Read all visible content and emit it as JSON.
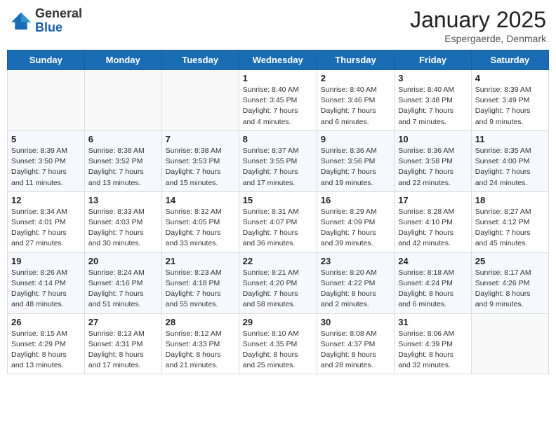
{
  "logo": {
    "general": "General",
    "blue": "Blue"
  },
  "header": {
    "month": "January 2025",
    "location": "Espergaerde, Denmark"
  },
  "weekdays": [
    "Sunday",
    "Monday",
    "Tuesday",
    "Wednesday",
    "Thursday",
    "Friday",
    "Saturday"
  ],
  "weeks": [
    [
      {
        "day": "",
        "info": ""
      },
      {
        "day": "",
        "info": ""
      },
      {
        "day": "",
        "info": ""
      },
      {
        "day": "1",
        "info": "Sunrise: 8:40 AM\nSunset: 3:45 PM\nDaylight: 7 hours\nand 4 minutes."
      },
      {
        "day": "2",
        "info": "Sunrise: 8:40 AM\nSunset: 3:46 PM\nDaylight: 7 hours\nand 6 minutes."
      },
      {
        "day": "3",
        "info": "Sunrise: 8:40 AM\nSunset: 3:48 PM\nDaylight: 7 hours\nand 7 minutes."
      },
      {
        "day": "4",
        "info": "Sunrise: 8:39 AM\nSunset: 3:49 PM\nDaylight: 7 hours\nand 9 minutes."
      }
    ],
    [
      {
        "day": "5",
        "info": "Sunrise: 8:39 AM\nSunset: 3:50 PM\nDaylight: 7 hours\nand 11 minutes."
      },
      {
        "day": "6",
        "info": "Sunrise: 8:38 AM\nSunset: 3:52 PM\nDaylight: 7 hours\nand 13 minutes."
      },
      {
        "day": "7",
        "info": "Sunrise: 8:38 AM\nSunset: 3:53 PM\nDaylight: 7 hours\nand 15 minutes."
      },
      {
        "day": "8",
        "info": "Sunrise: 8:37 AM\nSunset: 3:55 PM\nDaylight: 7 hours\nand 17 minutes."
      },
      {
        "day": "9",
        "info": "Sunrise: 8:36 AM\nSunset: 3:56 PM\nDaylight: 7 hours\nand 19 minutes."
      },
      {
        "day": "10",
        "info": "Sunrise: 8:36 AM\nSunset: 3:58 PM\nDaylight: 7 hours\nand 22 minutes."
      },
      {
        "day": "11",
        "info": "Sunrise: 8:35 AM\nSunset: 4:00 PM\nDaylight: 7 hours\nand 24 minutes."
      }
    ],
    [
      {
        "day": "12",
        "info": "Sunrise: 8:34 AM\nSunset: 4:01 PM\nDaylight: 7 hours\nand 27 minutes."
      },
      {
        "day": "13",
        "info": "Sunrise: 8:33 AM\nSunset: 4:03 PM\nDaylight: 7 hours\nand 30 minutes."
      },
      {
        "day": "14",
        "info": "Sunrise: 8:32 AM\nSunset: 4:05 PM\nDaylight: 7 hours\nand 33 minutes."
      },
      {
        "day": "15",
        "info": "Sunrise: 8:31 AM\nSunset: 4:07 PM\nDaylight: 7 hours\nand 36 minutes."
      },
      {
        "day": "16",
        "info": "Sunrise: 8:29 AM\nSunset: 4:09 PM\nDaylight: 7 hours\nand 39 minutes."
      },
      {
        "day": "17",
        "info": "Sunrise: 8:28 AM\nSunset: 4:10 PM\nDaylight: 7 hours\nand 42 minutes."
      },
      {
        "day": "18",
        "info": "Sunrise: 8:27 AM\nSunset: 4:12 PM\nDaylight: 7 hours\nand 45 minutes."
      }
    ],
    [
      {
        "day": "19",
        "info": "Sunrise: 8:26 AM\nSunset: 4:14 PM\nDaylight: 7 hours\nand 48 minutes."
      },
      {
        "day": "20",
        "info": "Sunrise: 8:24 AM\nSunset: 4:16 PM\nDaylight: 7 hours\nand 51 minutes."
      },
      {
        "day": "21",
        "info": "Sunrise: 8:23 AM\nSunset: 4:18 PM\nDaylight: 7 hours\nand 55 minutes."
      },
      {
        "day": "22",
        "info": "Sunrise: 8:21 AM\nSunset: 4:20 PM\nDaylight: 7 hours\nand 58 minutes."
      },
      {
        "day": "23",
        "info": "Sunrise: 8:20 AM\nSunset: 4:22 PM\nDaylight: 8 hours\nand 2 minutes."
      },
      {
        "day": "24",
        "info": "Sunrise: 8:18 AM\nSunset: 4:24 PM\nDaylight: 8 hours\nand 6 minutes."
      },
      {
        "day": "25",
        "info": "Sunrise: 8:17 AM\nSunset: 4:26 PM\nDaylight: 8 hours\nand 9 minutes."
      }
    ],
    [
      {
        "day": "26",
        "info": "Sunrise: 8:15 AM\nSunset: 4:29 PM\nDaylight: 8 hours\nand 13 minutes."
      },
      {
        "day": "27",
        "info": "Sunrise: 8:13 AM\nSunset: 4:31 PM\nDaylight: 8 hours\nand 17 minutes."
      },
      {
        "day": "28",
        "info": "Sunrise: 8:12 AM\nSunset: 4:33 PM\nDaylight: 8 hours\nand 21 minutes."
      },
      {
        "day": "29",
        "info": "Sunrise: 8:10 AM\nSunset: 4:35 PM\nDaylight: 8 hours\nand 25 minutes."
      },
      {
        "day": "30",
        "info": "Sunrise: 8:08 AM\nSunset: 4:37 PM\nDaylight: 8 hours\nand 28 minutes."
      },
      {
        "day": "31",
        "info": "Sunrise: 8:06 AM\nSunset: 4:39 PM\nDaylight: 8 hours\nand 32 minutes."
      },
      {
        "day": "",
        "info": ""
      }
    ]
  ]
}
